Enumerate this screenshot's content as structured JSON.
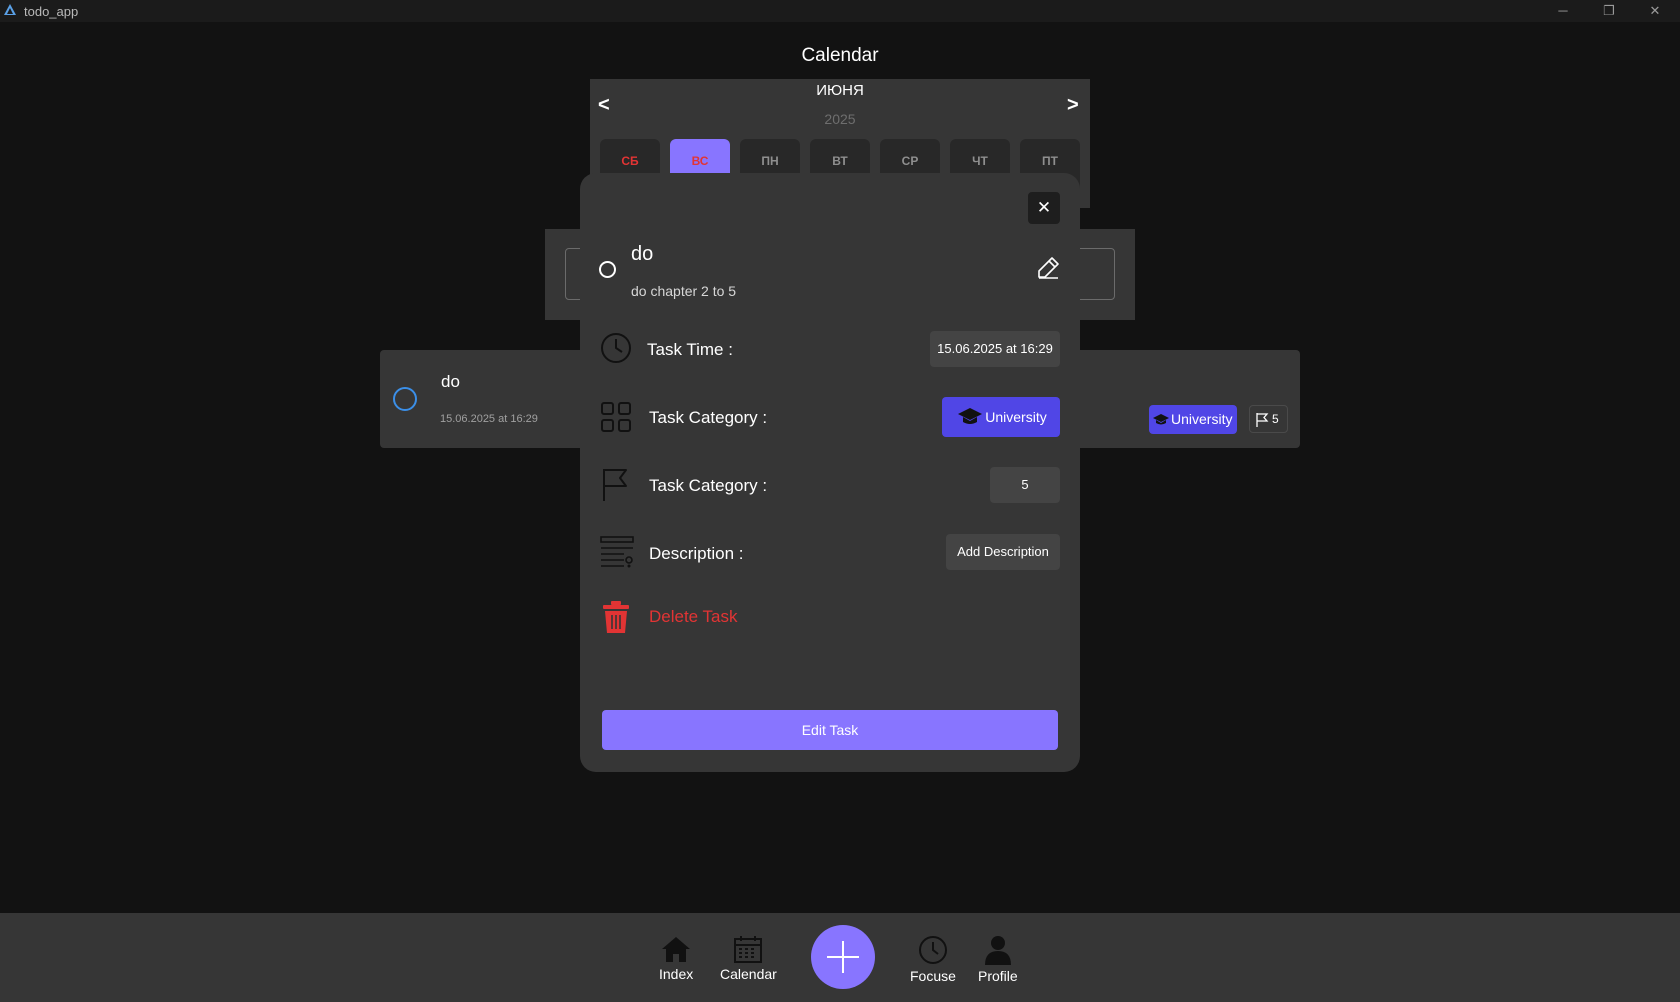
{
  "window": {
    "title": "todo_app"
  },
  "page": {
    "title": "Calendar"
  },
  "calendar": {
    "month": "ИЮНЯ",
    "year": "2025",
    "prev_arrow": "<",
    "next_arrow": ">",
    "days": [
      {
        "label": "СБ",
        "selected": false,
        "weekend": true
      },
      {
        "label": "ВС",
        "selected": true,
        "weekend": true
      },
      {
        "label": "ПН",
        "selected": false,
        "weekend": false
      },
      {
        "label": "ВТ",
        "selected": false,
        "weekend": false
      },
      {
        "label": "СР",
        "selected": false,
        "weekend": false
      },
      {
        "label": "ЧТ",
        "selected": false,
        "weekend": false
      },
      {
        "label": "ПТ",
        "selected": false,
        "weekend": false
      }
    ]
  },
  "task_card": {
    "name": "do",
    "time": "15.06.2025 at 16:29",
    "category": "University",
    "priority": "5"
  },
  "modal": {
    "close_label": "✕",
    "title": "do",
    "description": "do chapter 2 to 5",
    "rows": {
      "time_label": "Task Time :",
      "time_value": "15.06.2025 at 16:29",
      "category_label": "Task Category :",
      "category_value": "University",
      "priority_label": "Task Category :",
      "priority_value": "5",
      "description_label": "Description :",
      "description_button": "Add Description"
    },
    "delete_label": "Delete Task",
    "edit_button": "Edit Task"
  },
  "bottom_nav": {
    "items": [
      {
        "label": "Index"
      },
      {
        "label": "Calendar"
      },
      {
        "label": "Focuse"
      },
      {
        "label": "Profile"
      }
    ]
  },
  "colors": {
    "accent": "#8875ff",
    "category": "#5046e6",
    "danger": "#e23434",
    "background": "#121212",
    "surface": "#363636"
  }
}
